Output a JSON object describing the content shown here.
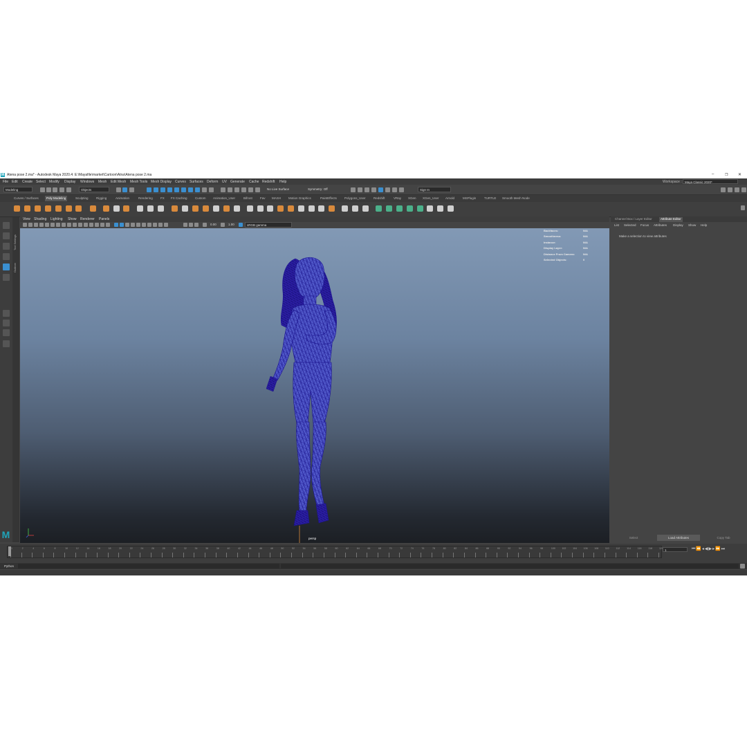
{
  "window": {
    "title": "Atena pose 2.ma* - Autodesk Maya 2020.4: E:\\Mayafile\\market\\Cartoon\\Atna\\Atena pose 2.ma",
    "logo": "M"
  },
  "menu": [
    "File",
    "Edit",
    "Create",
    "Select",
    "Modify",
    "Display",
    "Windows",
    "Mesh",
    "Edit Mesh",
    "Mesh Tools",
    "Mesh Display",
    "Curves",
    "Surfaces",
    "Deform",
    "UV",
    "Generate",
    "Cache",
    "Redshift",
    "Help"
  ],
  "workspace": {
    "label": "Workspace :",
    "value": "Maya Classic 2020*"
  },
  "statusline": {
    "mode": "Modeling",
    "select_mode": "Objects",
    "live_surface": "No Live Surface",
    "symmetry": "Symmetry: Off",
    "sign_in": "Sign In"
  },
  "shelf_tabs": [
    "Curves / Surfaces",
    "Poly Modeling",
    "Sculpting",
    "Rigging",
    "Animation",
    "Rendering",
    "FX",
    "FX Caching",
    "Custom",
    "Animation_User",
    "Bifrost",
    "Fav",
    "MASH",
    "Motion Graphics",
    "PaintEffects",
    "Polygons_User",
    "Redshift",
    "VRay",
    "XGen",
    "XGen_User",
    "Arnold",
    "MSPlugin",
    "TURTLE",
    "Smooth Mesh Node"
  ],
  "active_shelf_tab": "Poly Modeling",
  "panel_menu": [
    "View",
    "Shading",
    "Lighting",
    "Show",
    "Renderer",
    "Panels"
  ],
  "panel_tools": {
    "exposure": "0.00",
    "gamma": "1.00",
    "color_space": "sRGB gamma"
  },
  "toolbox_side_labels": [
    "Tool Settings",
    "Outliner"
  ],
  "hud": [
    {
      "label": "Backfaces:",
      "value": "N/A"
    },
    {
      "label": "Smoothness:",
      "value": "N/A"
    },
    {
      "label": "Instance:",
      "value": "N/A"
    },
    {
      "label": "Display Layer:",
      "value": "N/A"
    },
    {
      "label": "Distance From Camera:",
      "value": "N/A"
    },
    {
      "label": "Selected Objects:",
      "value": "0"
    }
  ],
  "camera_label": "persp",
  "attribute_editor": {
    "tabs": [
      "Channel Box / Layer Editor",
      "Attribute Editor"
    ],
    "active_tab": "Attribute Editor",
    "menu": [
      "List",
      "Selected",
      "Focus",
      "Attributes",
      "Display",
      "Show",
      "Help"
    ],
    "message": "Make a selection to view attributes",
    "buttons": [
      "Select",
      "Load Attributes",
      "Copy Tab"
    ]
  },
  "timeline": {
    "ticks": [
      "1",
      "2",
      "4",
      "6",
      "8",
      "10",
      "12",
      "14",
      "16",
      "18",
      "20",
      "22",
      "24",
      "26",
      "28",
      "30",
      "32",
      "34",
      "36",
      "38",
      "40",
      "42",
      "44",
      "46",
      "48",
      "50",
      "52",
      "54",
      "56",
      "58",
      "60",
      "62",
      "64",
      "66",
      "68",
      "70",
      "72",
      "74",
      "76",
      "78",
      "80",
      "82",
      "84",
      "86",
      "88",
      "90",
      "92",
      "94",
      "96",
      "98",
      "100",
      "102",
      "104",
      "106",
      "108",
      "110",
      "112",
      "114",
      "116",
      "118",
      "120"
    ],
    "current_frame": "1"
  },
  "command_line": {
    "label": "Python"
  },
  "colors": {
    "accent": "#3a8fd0",
    "shelf_orange": "#d98a3c",
    "maya_logo": "#1fa3b8",
    "mesh_wire": "#2a1fb0"
  }
}
